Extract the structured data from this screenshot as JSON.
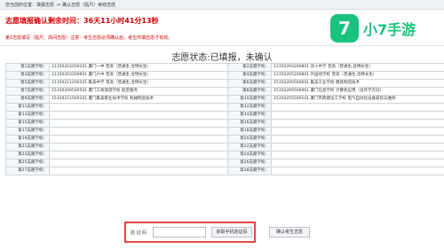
{
  "topbar": {
    "breadcrumb": "您当前的位置：填报志愿 -> 确认志愿（贴尺）考结志愿"
  },
  "countdown": "志愿填报确认剩余时间：36天11小时41分13秒",
  "notice": "第1志愿填写（贴尺、高间志愿）注意：考生志愿必须确认后，考生所填志愿才有效。",
  "logo": {
    "name": "小7手游",
    "icon": "7"
  },
  "status_title": "志愿状态:已填报，未确认",
  "rows": [
    {
      "left_label": "第1志愿学校：",
      "left_value": "11350203200101 厦门一中 普高（普通生,含特长生）",
      "right_label": "第2志愿学校：",
      "right_value": "11350203200801 双十中学 普高（普通生,含特长生）"
    },
    {
      "left_label": "第3志愿学校：",
      "left_value": "11350203200601 厦门六中 普高（普通生,含特长生）",
      "right_label": "第4志愿学校：",
      "right_value": "11350205200801 外国语学校 普高（普通生,含特长生）"
    },
    {
      "left_label": "第5志愿学校：",
      "left_value": "11350211200101 集美中学 普高（普通生,含特长生）",
      "right_label": "第6志愿学校：",
      "right_value": "15350200500601 集美工业学校 模具制造技术"
    },
    {
      "left_label": "第7志愿学校：",
      "left_value": "15350200500501 厦门工商旅游学校 航空服务",
      "right_label": "第8志愿学校：",
      "right_value": "15350200500901 厦门信息学校 计算机应用（含开学方向）"
    },
    {
      "left_label": "第9志愿学校：",
      "left_value": "15350211500101 厦门集美职业技术学校 机械制造技术",
      "right_label": "第10志愿学校：",
      "right_value": "15350255500101 厦门市政建设工学校 电气自动化设备安装与维修"
    },
    {
      "left_label": "第11志愿学校：",
      "left_value": "",
      "right_label": "第12志愿学校：",
      "right_value": ""
    },
    {
      "left_label": "第13志愿学校：",
      "left_value": "",
      "right_label": "第14志愿学校：",
      "right_value": ""
    },
    {
      "left_label": "第15志愿学校：",
      "left_value": "",
      "right_label": "第16志愿学校：",
      "right_value": ""
    },
    {
      "left_label": "第17志愿学校：",
      "left_value": "",
      "right_label": "第18志愿学校：",
      "right_value": ""
    },
    {
      "left_label": "第19志愿学校：",
      "left_value": "",
      "right_label": "第20志愿学校：",
      "right_value": ""
    },
    {
      "left_label": "第21志愿学校：",
      "left_value": "",
      "right_label": "第22志愿学校：",
      "right_value": ""
    },
    {
      "left_label": "第23志愿学校：",
      "left_value": "",
      "right_label": "第24志愿学校：",
      "right_value": ""
    },
    {
      "left_label": "第25志愿学校：",
      "left_value": "",
      "right_label": "第26志愿学校：",
      "right_value": ""
    },
    {
      "left_label": "第27志愿学校：",
      "left_value": "",
      "right_label": "第28志愿学校：",
      "right_value": ""
    }
  ],
  "verify": {
    "label": "验 证 码",
    "input_value": "",
    "sms_button": "获取手机验证码",
    "confirm_button": "确认考生志愿"
  },
  "colors": {
    "accent_red": "#d00000",
    "highlight_box": "#e64545",
    "brand_green": "#19c37d"
  }
}
